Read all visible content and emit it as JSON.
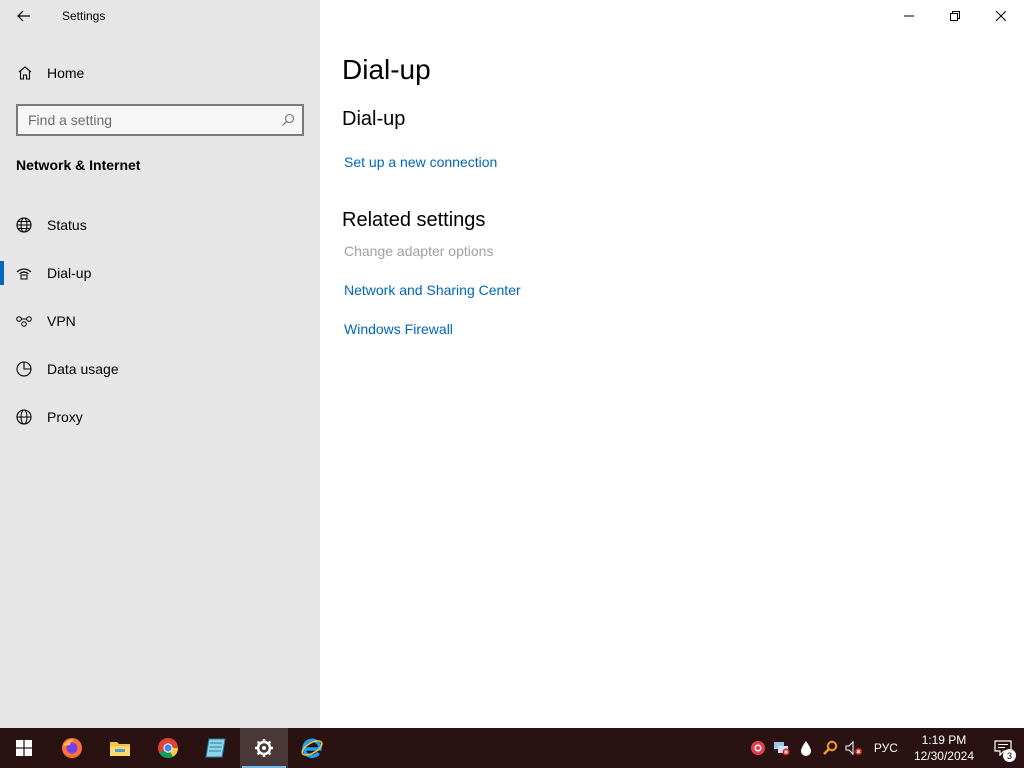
{
  "window": {
    "app_title": "Settings",
    "back_icon": "back-arrow-icon",
    "minimize_icon": "minimize-icon",
    "restore_icon": "restore-icon",
    "close_icon": "close-icon"
  },
  "sidebar": {
    "home_label": "Home",
    "search_placeholder": "Find a setting",
    "section_title": "Network & Internet",
    "items": [
      {
        "label": "Status",
        "icon": "globe-status-icon",
        "selected": false
      },
      {
        "label": "Dial-up",
        "icon": "dialup-icon",
        "selected": true
      },
      {
        "label": "VPN",
        "icon": "vpn-icon",
        "selected": false
      },
      {
        "label": "Data usage",
        "icon": "data-usage-icon",
        "selected": false
      },
      {
        "label": "Proxy",
        "icon": "globe-proxy-icon",
        "selected": false
      }
    ]
  },
  "main": {
    "page_title": "Dial-up",
    "section_title": "Dial-up",
    "setup_link": "Set up a new connection",
    "related_title": "Related settings",
    "related_links": [
      {
        "label": "Change adapter options",
        "disabled": true
      },
      {
        "label": "Network and Sharing Center",
        "disabled": false
      },
      {
        "label": "Windows Firewall",
        "disabled": false
      }
    ]
  },
  "taskbar": {
    "apps": [
      "windows-start-icon",
      "firefox-icon",
      "file-explorer-icon",
      "chrome-icon",
      "notepad-icon",
      "settings-gear-icon",
      "internet-explorer-icon"
    ],
    "active_app": "settings-gear-icon",
    "tray_icons": [
      "antivirus-icon",
      "network-error-icon",
      "drop-icon",
      "search-tool-icon",
      "volume-muted-icon"
    ],
    "language": "РУС",
    "time": "1:19 PM",
    "date": "12/30/2024",
    "notification_count": "3"
  },
  "colors": {
    "accent": "#0067b8",
    "sidebar_bg": "#e6e6e6",
    "taskbar_bg": "#2a1212",
    "disabled_link": "#a0a0a0"
  }
}
